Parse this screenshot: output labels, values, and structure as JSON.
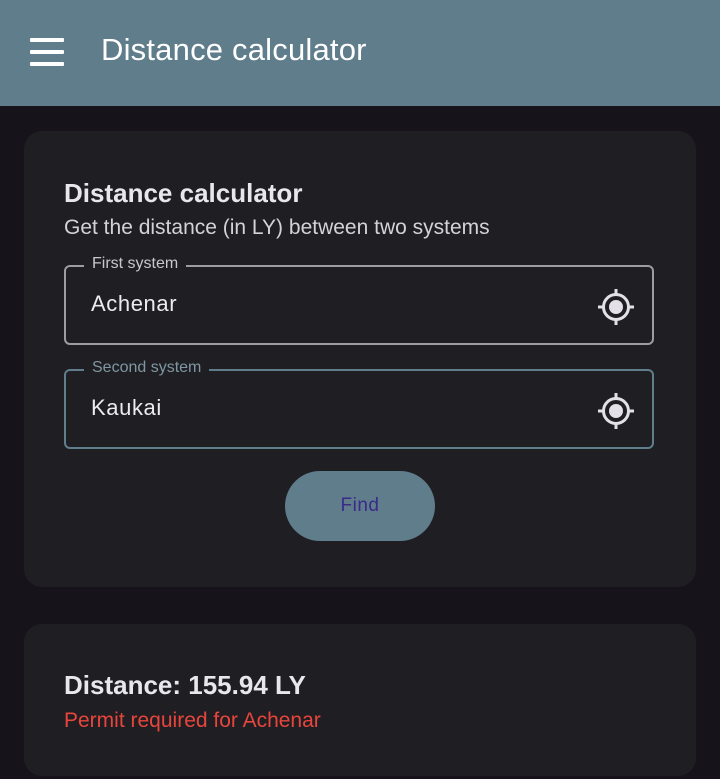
{
  "app_bar": {
    "title": "Distance calculator",
    "menu_icon": "hamburger-menu-icon",
    "background": "#5f7d8b"
  },
  "calculator_card": {
    "title": "Distance calculator",
    "subtitle": "Get the distance (in LY) between two systems",
    "first_field": {
      "label": "First system",
      "value": "Achenar",
      "icon": "gps-target-icon"
    },
    "second_field": {
      "label": "Second system",
      "value": "Kaukai",
      "icon": "gps-target-icon"
    },
    "find_button": "Find"
  },
  "result_card": {
    "distance": "Distance: 155.94 LY",
    "permit_warning": "Permit required for Achenar",
    "warning_color": "#e8453c"
  }
}
